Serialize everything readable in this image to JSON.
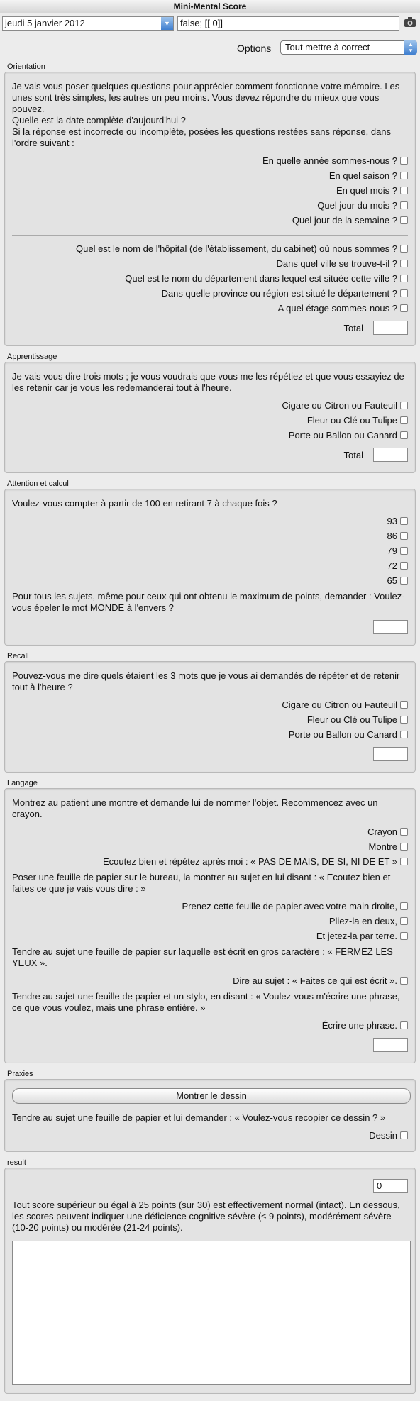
{
  "window": {
    "title": "Mini-Mental Score"
  },
  "toolbar": {
    "date": "jeudi 5 janvier 2012",
    "value": "false; [[ 0]]",
    "camera_icon": "camera-icon"
  },
  "options": {
    "label": "Options",
    "selected": "Tout mettre à correct"
  },
  "orientation": {
    "label": "Orientation",
    "intro": "Je vais vous poser quelques questions pour apprécier comment fonctionne votre mémoire. Les unes sont très simples, les autres un peu moins. Vous devez répondre du mieux que vous pouvez.",
    "q_date": "Quelle est la date complète d'aujourd'hui ?",
    "q_order": "Si la réponse est incorrecte ou incomplète, posées les questions restées sans réponse, dans l'ordre suivant :",
    "items_time": [
      "En quelle année sommes-nous ?",
      "En quel saison ?",
      "En quel mois ?",
      "Quel jour du mois ?",
      "Quel jour de la semaine ?"
    ],
    "items_place": [
      "Quel est le nom de l'hôpital (de l'établissement, du cabinet) où nous sommes ?",
      "Dans quel ville se trouve-t-il ?",
      "Quel est le nom du département dans lequel est située cette ville ?",
      "Dans quelle province ou région est situé le département ?",
      "A quel étage sommes-nous ?"
    ],
    "total_label": "Total"
  },
  "apprentissage": {
    "label": "Apprentissage",
    "intro": "Je vais vous dire trois mots ; je vous voudrais que vous me les répétiez et que vous essayiez de les retenir car je vous les redemanderai tout à l'heure.",
    "items": [
      "Cigare ou Citron ou Fauteuil",
      "Fleur ou Clé ou Tulipe",
      "Porte ou Ballon ou Canard"
    ],
    "total_label": "Total"
  },
  "attention": {
    "label": "Attention et calcul",
    "intro": "Voulez-vous compter à partir de 100 en retirant 7 à chaque fois ?",
    "items": [
      "93",
      "86",
      "79",
      "72",
      "65"
    ],
    "monde": "Pour tous les sujets, même pour ceux qui ont obtenu le maximum de points, demander : Voulez-vous épeler le mot MONDE à l'envers ?"
  },
  "recall": {
    "label": "Recall",
    "intro": "Pouvez-vous me dire quels étaient les 3 mots que je vous ai demandés de répéter et de retenir tout à l'heure ?",
    "items": [
      "Cigare ou Citron ou Fauteuil",
      "Fleur ou Clé ou Tulipe",
      "Porte ou Ballon ou Canard"
    ]
  },
  "langage": {
    "label": "Langage",
    "intro": "Montrez au patient une montre et demande lui de nommer l'objet. Recommencez avec un crayon.",
    "items_a": [
      "Crayon",
      "Montre",
      "Ecoutez bien et répétez après moi : « PAS DE MAIS, DE SI, NI DE ET »"
    ],
    "feuille": "Poser une feuille de papier sur le bureau, la montrer au sujet en lui disant : « Ecoutez bien et faites ce que je vais vous dire : »",
    "items_b": [
      "Prenez cette feuille de papier avec votre main droite,",
      "Pliez-la en deux,",
      "Et jetez-la par terre."
    ],
    "fermez": "Tendre au sujet une feuille de papier sur laquelle est écrit en gros caractère : « FERMEZ LES YEUX ».",
    "item_c": "Dire au sujet : « Faites ce qui est écrit ».",
    "ecrire": "Tendre au sujet une feuille de papier et un stylo, en disant : « Voulez-vous m'écrire une phrase, ce que vous voulez, mais une phrase entière. »",
    "item_d": "Écrire une phrase."
  },
  "praxies": {
    "label": "Praxies",
    "button": "Montrer le dessin",
    "intro": "Tendre au sujet une feuille de papier et lui demander : « Voulez-vous recopier ce dessin ? »",
    "item": "Dessin"
  },
  "result": {
    "label": "result",
    "score": "0",
    "note": "Tout score supérieur ou égal à 25 points (sur 30) est effectivement normal (intact). En dessous, les scores peuvent indiquer une déficience cognitive sévère (≤ 9 points), modérément sévère (10-20 points) ou modérée (21-24 points)."
  }
}
